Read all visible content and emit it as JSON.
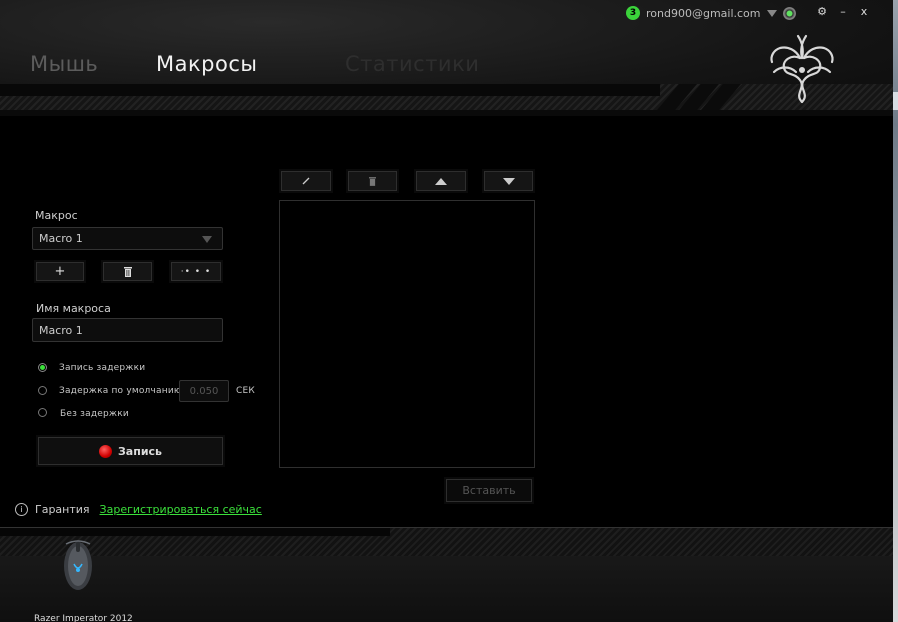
{
  "window": {
    "notification_count": "3",
    "user_email": "rond900@gmail.com",
    "gear_icon": "⚙",
    "minimize_label": "–",
    "close_label": "x"
  },
  "tabs": [
    {
      "label": "Мышь",
      "active": false
    },
    {
      "label": "Макросы",
      "active": true
    },
    {
      "label": "Статистики",
      "active": false
    }
  ],
  "macro": {
    "section_label": "Макрос",
    "selected": "Macro 1",
    "add_label": "+",
    "delete_icon": "trash-icon",
    "more_label": "·• • •"
  },
  "macro_name": {
    "label": "Имя макроса",
    "value": "Macro 1"
  },
  "delay_options": {
    "record_delay": "Запись задержки",
    "default_delay": "Задержка по умолчанию",
    "no_delay": "Без задержки",
    "default_delay_value": "0.050",
    "unit": "СЕК",
    "selected": "record_delay"
  },
  "record_button": "Запись",
  "event_toolbar": [
    "edit-icon",
    "trash-icon",
    "move-up-icon",
    "move-down-icon"
  ],
  "insert_button": "Вставить",
  "warranty": {
    "label": "Гарантия",
    "link": "Зарегистрироваться сейчас"
  },
  "device": {
    "name": "Razer Imperator 2012"
  },
  "colors": {
    "accent": "#3be03b",
    "record": "#e00000",
    "background": "#000000"
  }
}
